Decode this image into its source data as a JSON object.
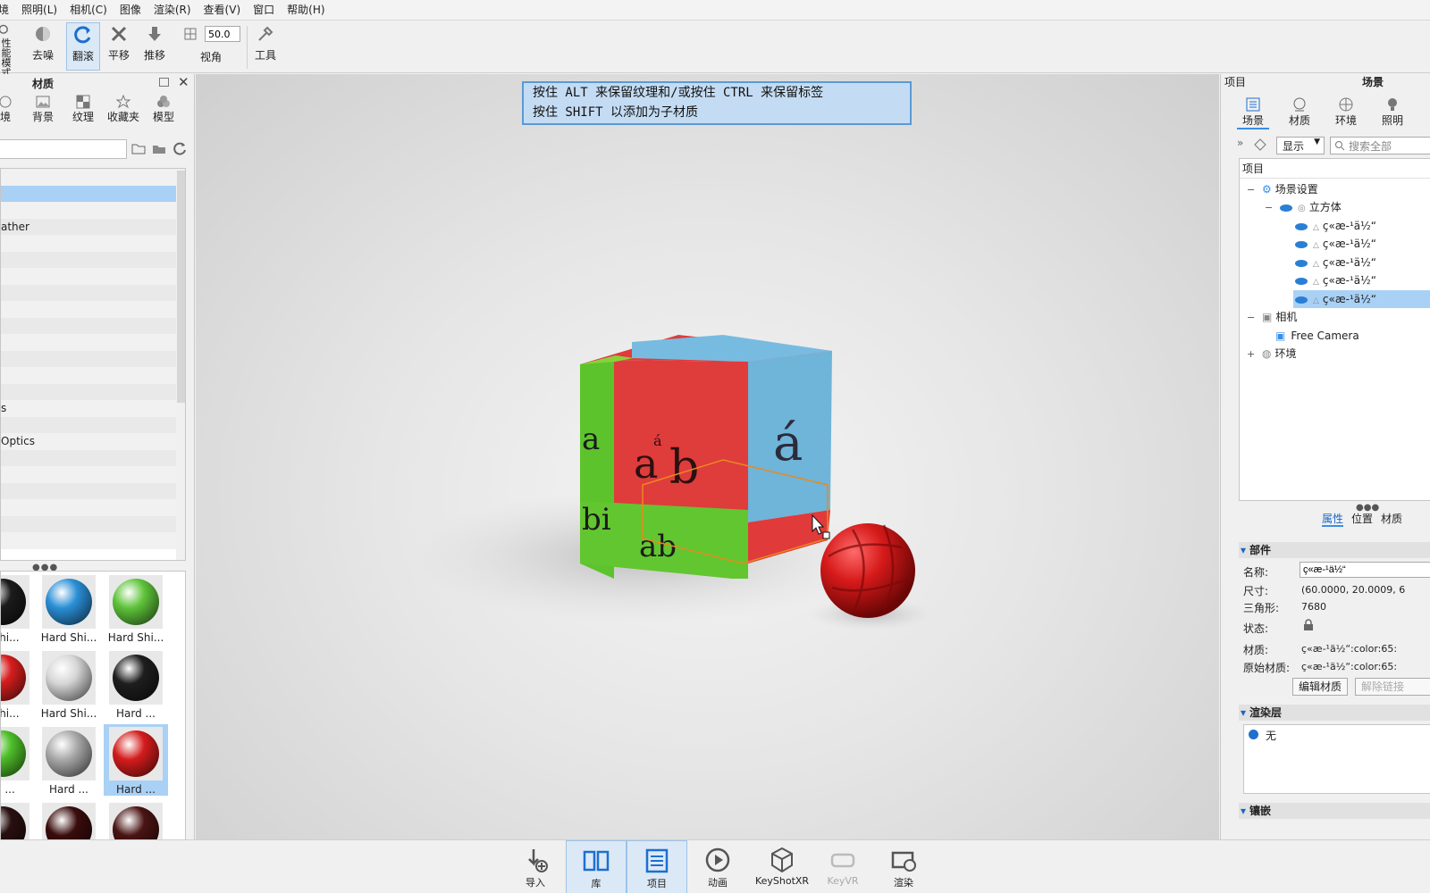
{
  "menu": [
    "境",
    "照明(L)",
    "相机(C)",
    "图像",
    "渲染(R)",
    "查看(V)",
    "窗口",
    "帮助(H)"
  ],
  "toolbar": {
    "perf_mode": "性能模式",
    "denoise": "去噪",
    "tumble": "翻滚",
    "pan": "平移",
    "dolly": "推移",
    "fov_value": "50.0",
    "fov_label": "视角",
    "tools": "工具"
  },
  "library": {
    "title": "材质",
    "tabs": [
      "境",
      "背景",
      "纹理",
      "收藏夹",
      "模型"
    ],
    "tree_items": [
      "",
      "",
      "",
      "ather",
      "",
      "",
      "",
      "",
      "",
      "",
      "",
      "",
      "",
      "",
      "s",
      "",
      "Optics",
      "",
      "",
      "",
      "",
      "",
      ""
    ],
    "selected_index": 1,
    "thumbnails": [
      {
        "name": "l Shi...",
        "color": "#1b1b1b"
      },
      {
        "name": "Hard Shi...",
        "color": "#2a8fd6"
      },
      {
        "name": "Hard Shi...",
        "color": "#5ec43a"
      },
      {
        "name": "l Shi...",
        "color": "#d81e1e"
      },
      {
        "name": "Hard Shi...",
        "color": "#d6d6d6"
      },
      {
        "name": "Hard ...",
        "color": "#1e1e1e"
      },
      {
        "name": "rd ...",
        "color": "#4fc02a"
      },
      {
        "name": "Hard ...",
        "color": "#a9a9a9"
      },
      {
        "name": "Hard ...",
        "color": "#d41c1c"
      },
      {
        "name": "...",
        "color": "#2a1010"
      },
      {
        "name": "...",
        "color": "#3a0c0c"
      },
      {
        "name": "...",
        "color": "#4a1414"
      }
    ],
    "selected_thumb": 8
  },
  "viewport": {
    "hint_line1": "按住 ALT 来保留纹理和/或按住 CTRL 来保留标签",
    "hint_line2": "按住 SHIFT 以添加为子材质"
  },
  "project": {
    "header_left": "项目",
    "header_right": "场景",
    "tabs": [
      "场景",
      "材质",
      "环境",
      "照明"
    ],
    "filter_select": "显示",
    "search_placeholder": "搜索全部",
    "tree_header": "项目",
    "tree": {
      "scene_settings": "场景设置",
      "cube": "立方体",
      "parts": [
        "ç«æ-¹ä½“",
        "ç«æ-¹ä½“",
        "ç«æ-¹ä½“",
        "ç«æ-¹ä½“",
        "ç«æ-¹ä½“"
      ],
      "camera": "相机",
      "free_camera": "Free Camera",
      "environment": "环境"
    },
    "prop_tabs": [
      "属性",
      "位置",
      "材质"
    ],
    "section_part": "部件",
    "name_label": "名称:",
    "name_value": "ç«æ-¹ä½“",
    "size_label": "尺寸:",
    "size_value": "(60.0000, 20.0009, 6",
    "tri_label": "三角形:",
    "tri_value": "7680",
    "state_label": "状态:",
    "mat_label": "材质:",
    "mat_value": "ç«æ-¹ä½“:color:65:",
    "orig_mat_label": "原始材质:",
    "orig_mat_value": "ç«æ-¹ä½“:color:65:",
    "edit_mat": "编辑材质",
    "unlink": "解除链接",
    "section_layer": "渲染层",
    "layer_none": "无",
    "section_more": "镶嵌"
  },
  "dock": [
    "导入",
    "库",
    "项目",
    "动画",
    "KeyShotXR",
    "KeyVR",
    "渲染"
  ]
}
